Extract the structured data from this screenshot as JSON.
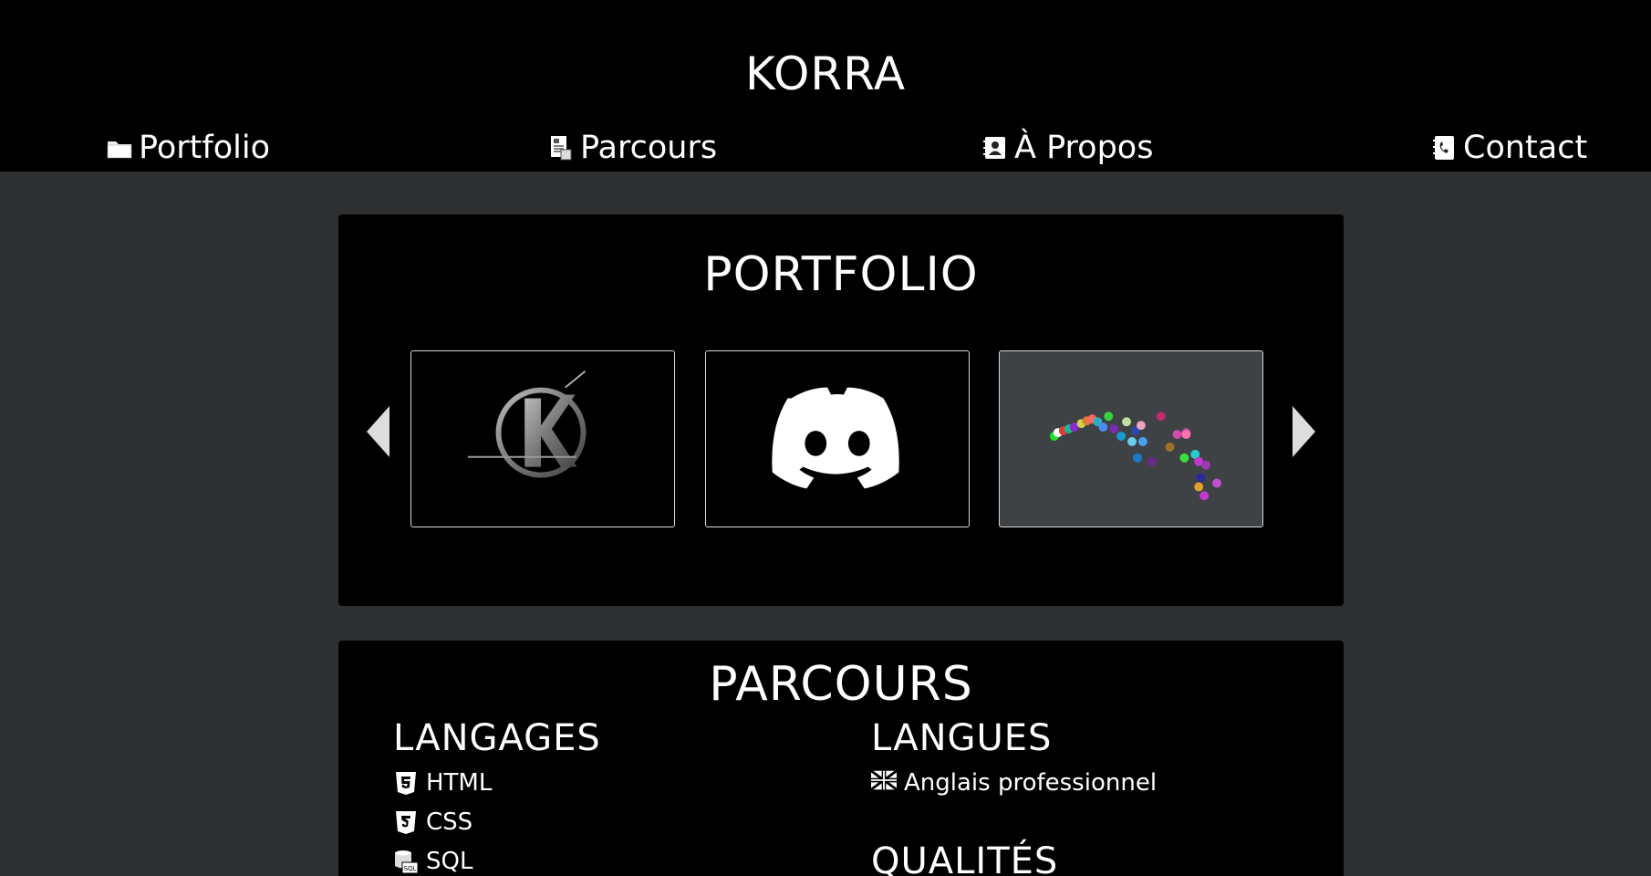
{
  "header": {
    "brand": "KORRA",
    "nav": [
      {
        "label": "Portfolio",
        "icon": "folder-icon"
      },
      {
        "label": "Parcours",
        "icon": "document-icon"
      },
      {
        "label": "À Propos",
        "icon": "contact-card-icon"
      },
      {
        "label": "Contact",
        "icon": "phone-book-icon"
      }
    ]
  },
  "portfolio": {
    "title": "PORTFOLIO",
    "tiles": [
      {
        "icon": "k-logo-icon"
      },
      {
        "icon": "discord-logo-icon"
      },
      {
        "icon": "particles-preview-icon"
      }
    ]
  },
  "parcours": {
    "title": "PARCOURS",
    "langages": {
      "title": "LANGAGES",
      "items": [
        {
          "label": "HTML",
          "icon": "html5-icon"
        },
        {
          "label": "CSS",
          "icon": "css3-icon"
        },
        {
          "label": "SQL",
          "icon": "database-sql-icon"
        }
      ]
    },
    "langues": {
      "title": "LANGUES",
      "items": [
        {
          "label": "Anglais professionnel",
          "icon": "uk-flag-icon"
        }
      ]
    },
    "qualites": {
      "title": "QUALITÉS"
    }
  },
  "colors": {
    "page_background": "#2e2f31",
    "card_background": "#000000",
    "text": "#ffffff",
    "tile_border": "#d9d9d9"
  }
}
